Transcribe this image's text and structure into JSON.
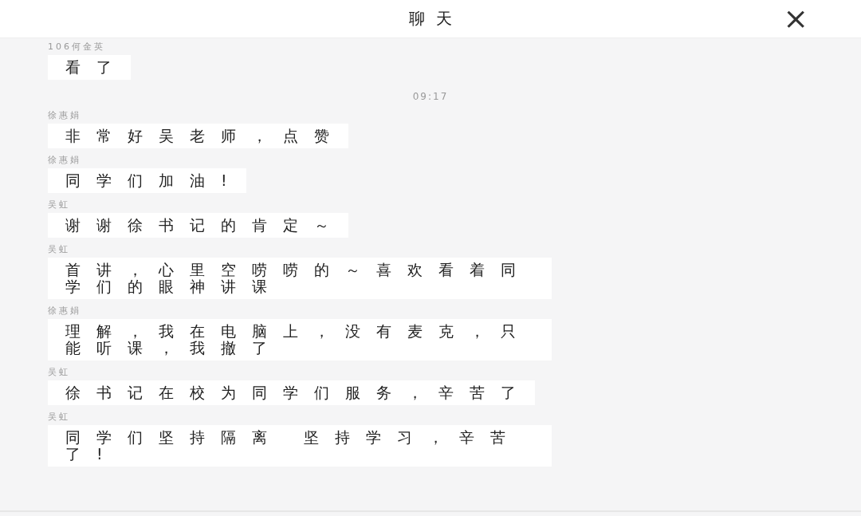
{
  "header": {
    "title": "聊天",
    "close": "×"
  },
  "items": [
    {
      "kind": "message",
      "sender": "106何金英",
      "text": "看了"
    },
    {
      "kind": "time",
      "text": "09:17"
    },
    {
      "kind": "message",
      "sender": "徐惠娟",
      "text": "非常好吴老师，点赞"
    },
    {
      "kind": "message",
      "sender": "徐惠娟",
      "text": "同学们加油!"
    },
    {
      "kind": "message",
      "sender": "吴虹",
      "text": "谢谢徐书记的肯定～"
    },
    {
      "kind": "message",
      "sender": "吴虹",
      "text": "首讲，心里空唠唠的～喜欢看着同学们的眼神讲课"
    },
    {
      "kind": "message",
      "sender": "徐惠娟",
      "text": "理解，我在电脑上，没有麦克，只能听课，我撤了"
    },
    {
      "kind": "message",
      "sender": "吴虹",
      "text": "徐书记在校为同学们服务，辛苦了"
    },
    {
      "kind": "message",
      "sender": "吴虹",
      "text": "同学们坚持隔离 坚持学习，辛苦了!"
    }
  ]
}
